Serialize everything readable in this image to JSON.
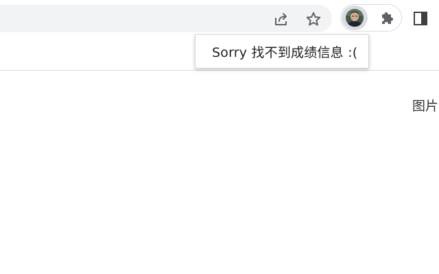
{
  "toolbar": {
    "icons": {
      "share": "share-icon",
      "bookmark": "star-icon",
      "profile": "avatar",
      "extensions": "puzzle-icon",
      "side_panel": "side-panel-icon"
    }
  },
  "popup": {
    "message": "Sorry 找不到成绩信息 :("
  },
  "content": {
    "label": "图片"
  },
  "colors": {
    "omnibox_bg": "#f1f3f4",
    "icon": "#5f6368",
    "divider": "#dadce0",
    "text": "#202124"
  }
}
